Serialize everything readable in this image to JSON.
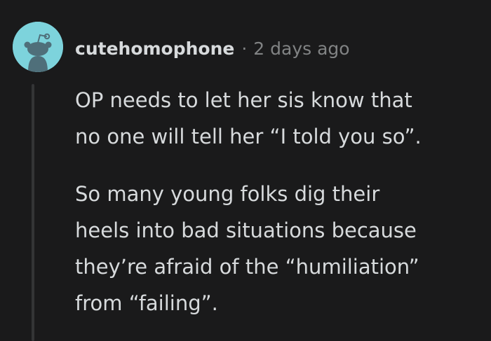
{
  "comment": {
    "author": "cutehomophone",
    "separator": "·",
    "timestamp": "2 days ago",
    "avatar_icon": "snoo-avatar-icon",
    "paragraphs": [
      "OP needs to let her sis know that\nno one will tell her “I told you so”.",
      "So many young folks dig their\nheels into bad situations because\nthey’re afraid of the “humiliation”\nfrom “failing”."
    ]
  },
  "colors": {
    "background": "#1a1a1b",
    "text": "#d7dadc",
    "meta": "#818384",
    "avatar_bg": "#7dd3dc",
    "thread_line": "#343536"
  }
}
